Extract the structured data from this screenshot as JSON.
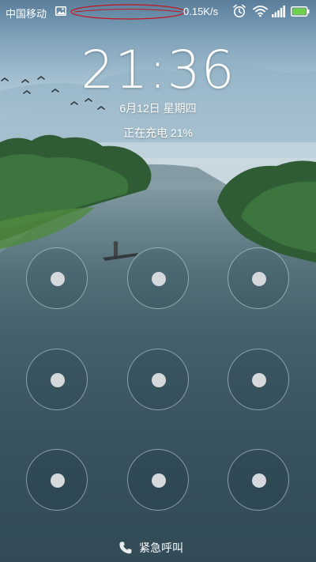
{
  "status_bar": {
    "carrier": "中国移动",
    "net_speed": "0.15K/s",
    "battery_color": "#6fd14a",
    "icons": [
      "image-notification-icon",
      "alarm-clock-icon",
      "wifi-icon",
      "signal-icon",
      "battery-icon"
    ]
  },
  "lockscreen": {
    "time": "21:36",
    "date": "6月12日 星期四",
    "charging_status": "正在充电 21%"
  },
  "pattern_lock": {
    "rows": 3,
    "cols": 3,
    "ring_color": "#d2e1e8",
    "dot_color": "#d6d9db"
  },
  "emergency": {
    "label": "紧急呼叫"
  }
}
